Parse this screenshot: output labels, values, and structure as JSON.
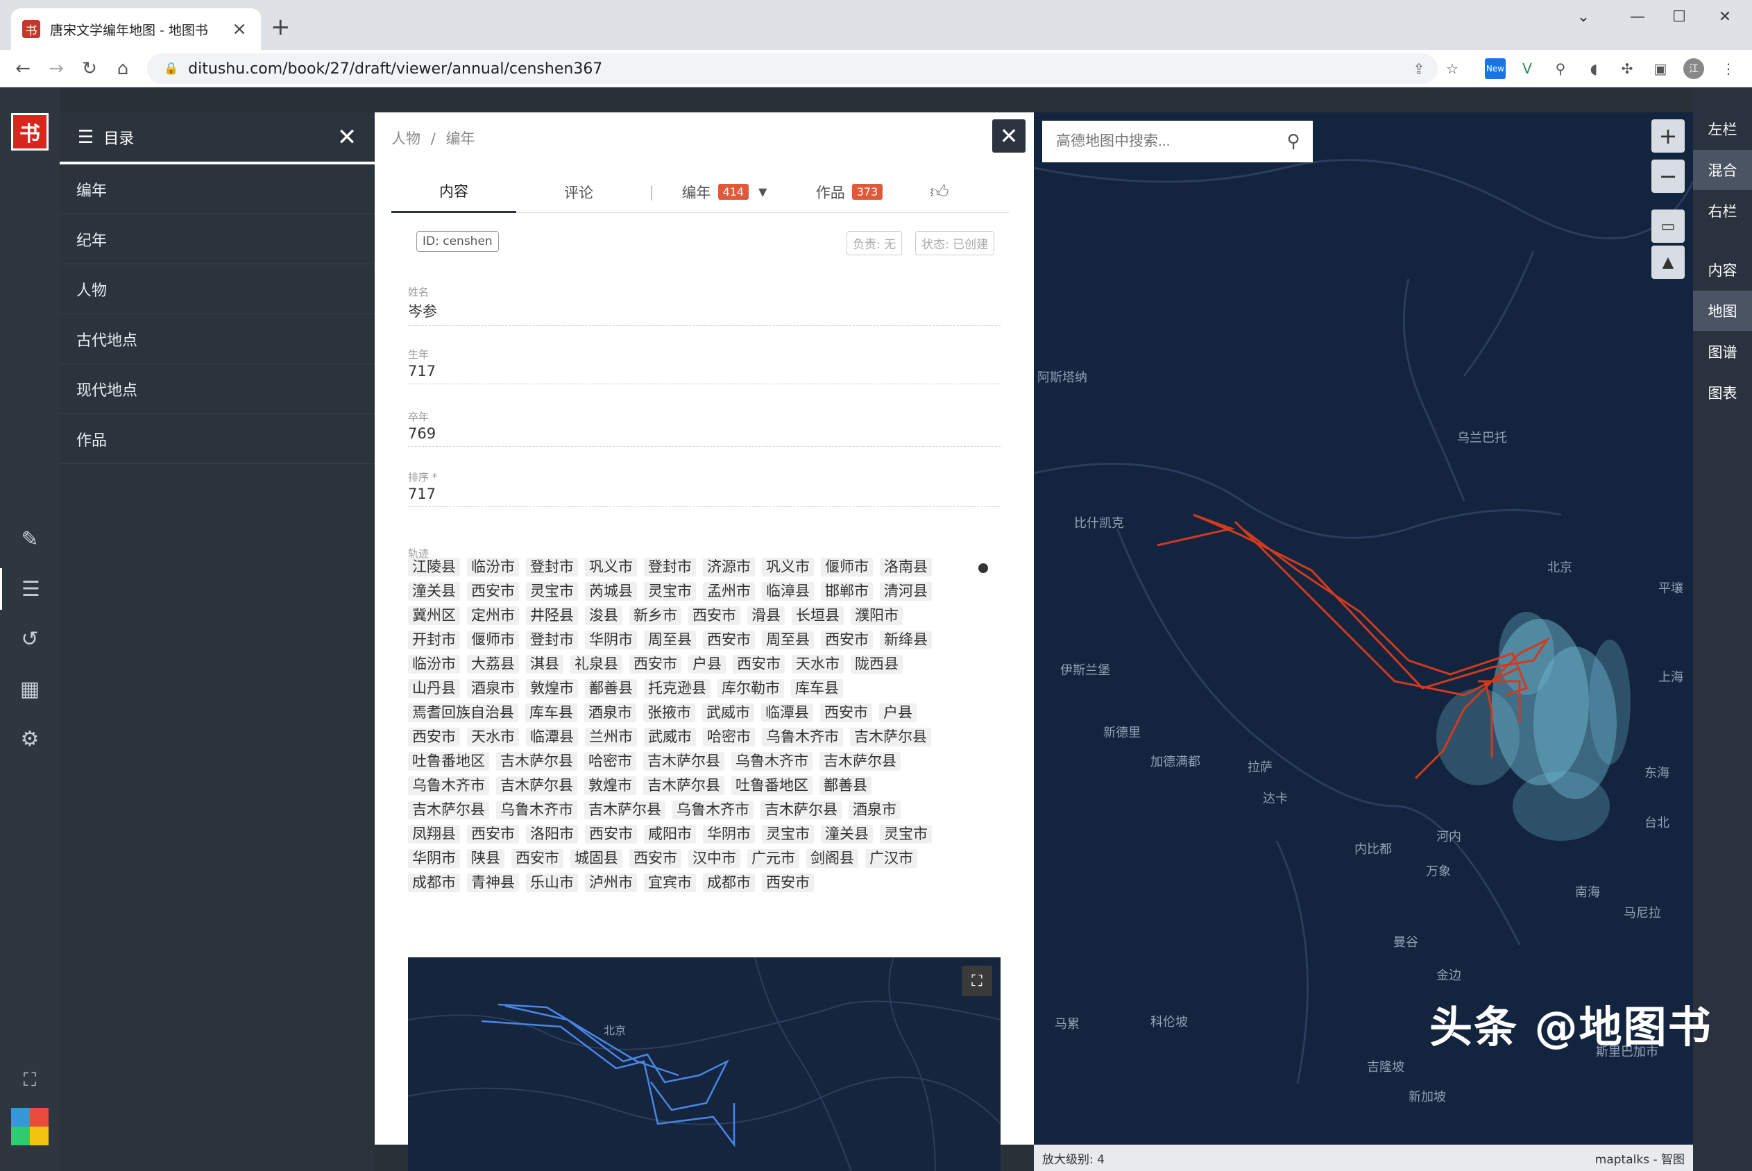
{
  "browser": {
    "tab_title": "唐宋文学编年地图 - 地图书",
    "tab_favicon": "书",
    "url": "ditushu.com/book/27/draft/viewer/annual/censhen367",
    "ext_badge": "New"
  },
  "toc": {
    "title": "目录",
    "items": [
      "编年",
      "纪年",
      "人物",
      "古代地点",
      "现代地点",
      "作品"
    ]
  },
  "panel": {
    "breadcrumb": [
      "人物",
      "编年"
    ],
    "tabs": {
      "content": "内容",
      "comments": "评论",
      "annals": "编年",
      "annals_count": "414",
      "works": "作品",
      "works_count": "373"
    },
    "id_tag": "ID: censhen",
    "owner_tag": "负责: 无",
    "state_tag": "状态: 已创建",
    "fields": [
      {
        "label": "姓名",
        "value": "岑参"
      },
      {
        "label": "生年",
        "value": "717"
      },
      {
        "label": "卒年",
        "value": "769"
      },
      {
        "label": "排序 *",
        "value": "717"
      }
    ],
    "trail_label": "轨迹",
    "trail": [
      "江陵县",
      "临汾市",
      "登封市",
      "巩义市",
      "登封市",
      "济源市",
      "巩义市",
      "偃师市",
      "洛南县",
      "潼关县",
      "西安市",
      "灵宝市",
      "芮城县",
      "灵宝市",
      "孟州市",
      "临漳县",
      "邯郸市",
      "清河县",
      "冀州区",
      "定州市",
      "井陉县",
      "浚县",
      "新乡市",
      "西安市",
      "滑县",
      "长垣县",
      "濮阳市",
      "开封市",
      "偃师市",
      "登封市",
      "华阴市",
      "周至县",
      "西安市",
      "周至县",
      "西安市",
      "新绛县",
      "临汾市",
      "大荔县",
      "淇县",
      "礼泉县",
      "西安市",
      "户县",
      "西安市",
      "天水市",
      "陇西县",
      "山丹县",
      "酒泉市",
      "敦煌市",
      "鄯善县",
      "托克逊县",
      "库尔勒市",
      "库车县",
      "焉耆回族自治县",
      "库车县",
      "酒泉市",
      "张掖市",
      "武威市",
      "临潭县",
      "西安市",
      "户县",
      "西安市",
      "天水市",
      "临潭县",
      "兰州市",
      "武威市",
      "哈密市",
      "乌鲁木齐市",
      "吉木萨尔县",
      "吐鲁番地区",
      "吉木萨尔县",
      "哈密市",
      "吉木萨尔县",
      "乌鲁木齐市",
      "吉木萨尔县",
      "乌鲁木齐市",
      "吉木萨尔县",
      "敦煌市",
      "吉木萨尔县",
      "吐鲁番地区",
      "鄯善县",
      "吉木萨尔县",
      "乌鲁木齐市",
      "吉木萨尔县",
      "乌鲁木齐市",
      "吉木萨尔县",
      "酒泉市",
      "凤翔县",
      "西安市",
      "洛阳市",
      "西安市",
      "咸阳市",
      "华阴市",
      "灵宝市",
      "潼关县",
      "灵宝市",
      "华阴市",
      "陕县",
      "西安市",
      "城固县",
      "西安市",
      "汉中市",
      "广元市",
      "剑阁县",
      "广汉市",
      "成都市",
      "青神县",
      "乐山市",
      "泸州市",
      "宜宾市",
      "成都市",
      "西安市"
    ],
    "minimap_label": "北京"
  },
  "map": {
    "search_placeholder": "高德地图中搜索...",
    "labels": [
      "阿斯塔纳",
      "乌兰巴托",
      "比什凯克",
      "北京",
      "平壤",
      "伊斯兰堡",
      "新德里",
      "加德满都",
      "拉萨",
      "达卡",
      "内比都",
      "河内",
      "万象",
      "曼谷",
      "金边",
      "上海",
      "台北",
      "东海",
      "南海",
      "马尼拉",
      "斯里巴加市",
      "吉隆坡",
      "新加坡",
      "马累",
      "科伦坡"
    ],
    "zoom_text": "放大级别: 4",
    "attribution": "maptalks - 智图"
  },
  "rightbar": {
    "items": [
      "左栏",
      "混合",
      "右栏",
      "内容",
      "地图",
      "图谱",
      "图表"
    ]
  },
  "watermark": "头条 @地图书",
  "colors": {
    "route": "#d23a1e",
    "minimap_route": "#4a86e8",
    "map_bg": "#13243e",
    "points": "#7fd3ea"
  }
}
